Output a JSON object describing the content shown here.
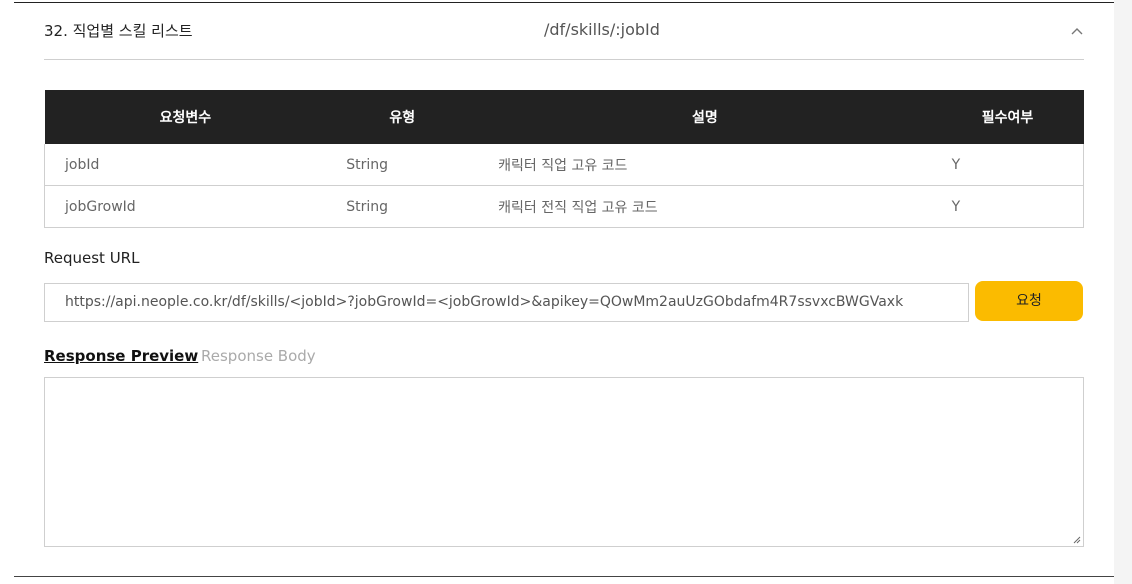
{
  "section": {
    "title": "32. 직업별 스킬 리스트",
    "path": "/df/skills/:jobId",
    "collapse_icon": "chevron-up-icon"
  },
  "params_table": {
    "headers": [
      "요청변수",
      "유형",
      "설명",
      "필수여부"
    ],
    "rows": [
      {
        "name": "jobId",
        "type": "String",
        "desc": "캐릭터 직업 고유 코드",
        "required": "Y"
      },
      {
        "name": "jobGrowId",
        "type": "String",
        "desc": "캐릭터 전직 직업 고유 코드",
        "required": "Y"
      }
    ]
  },
  "request": {
    "label": "Request URL",
    "url": "https://api.neople.co.kr/df/skills/<jobId>?jobGrowId=<jobGrowId>&apikey=QOwMm2auUzGObdafm4R7ssvxcBWGVaxk",
    "button_label": "요청",
    "button_color": "#fbbb00"
  },
  "response": {
    "tabs": [
      "Response Preview",
      "Response Body"
    ],
    "active_tab": "Response Preview",
    "content": ""
  }
}
